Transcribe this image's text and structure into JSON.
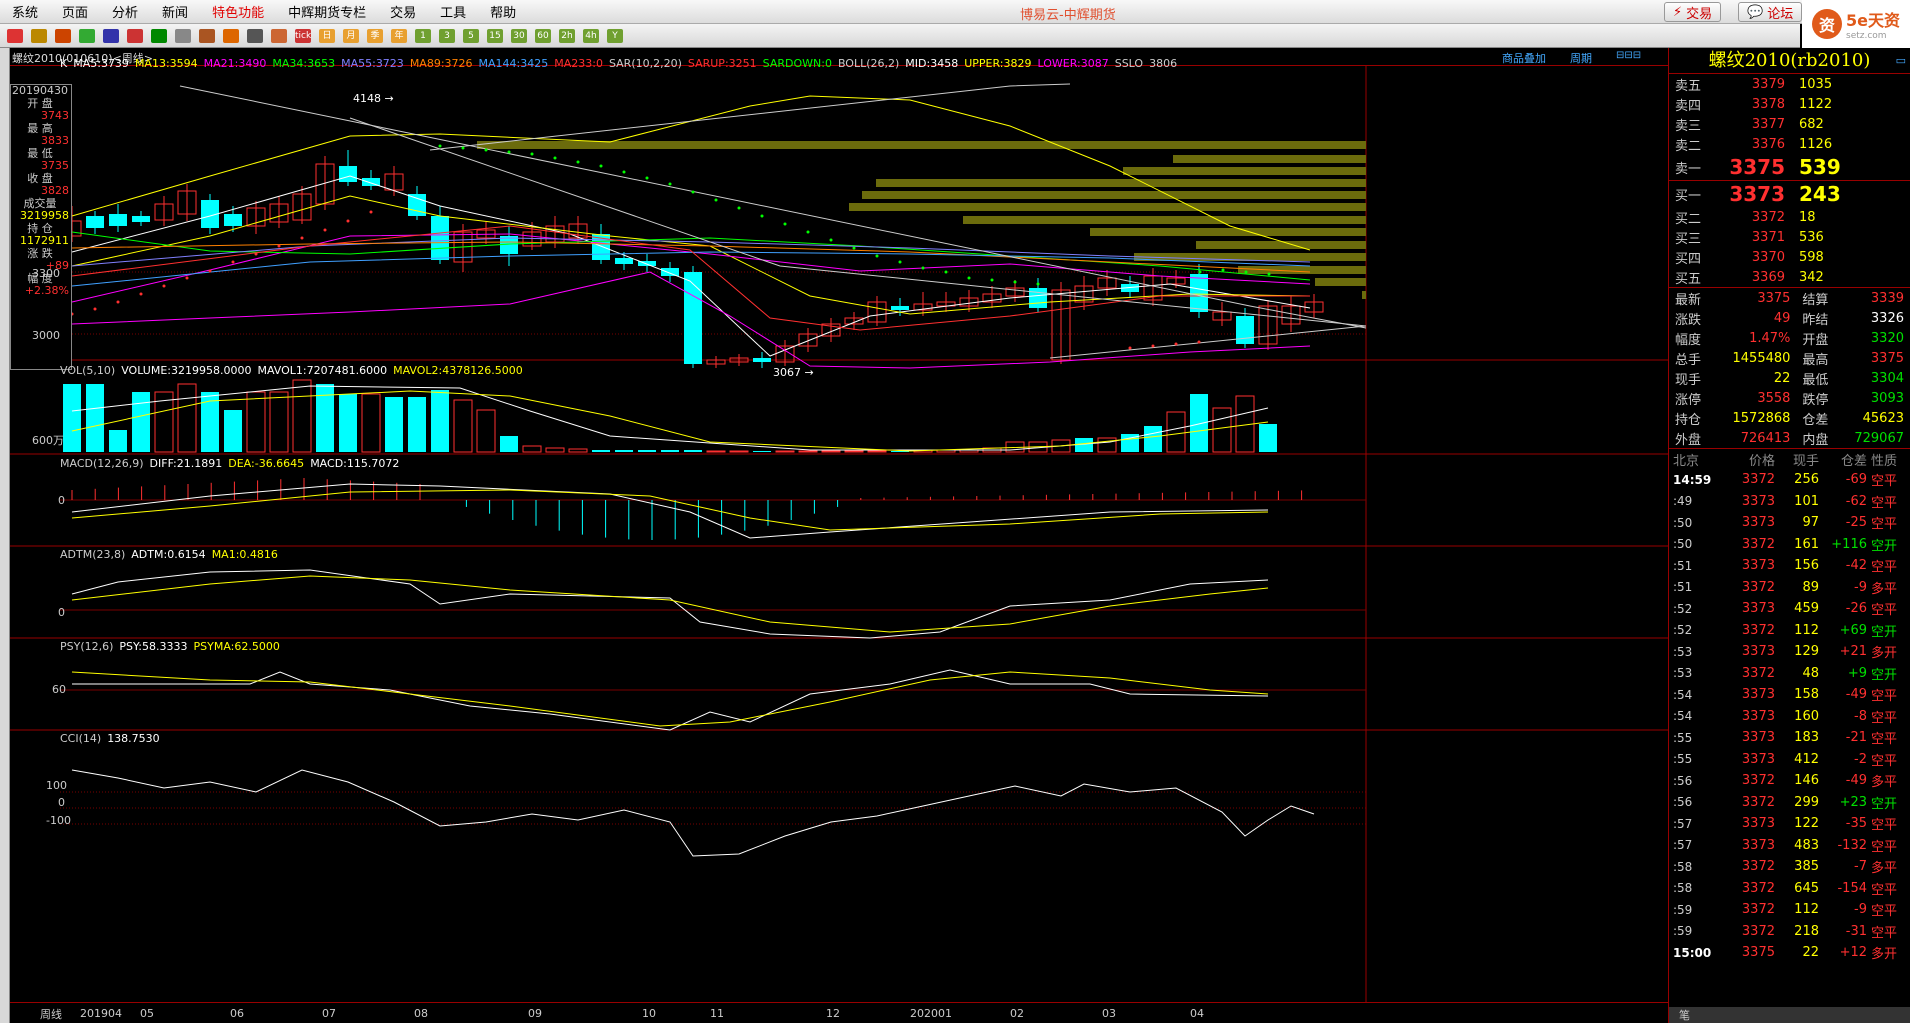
{
  "menu": [
    "系统",
    "页面",
    "分析",
    "新闻",
    "特色功能",
    "中辉期货专栏",
    "交易",
    "工具",
    "帮助"
  ],
  "app_title": "博易云-中辉期货",
  "trade_btn": "交易",
  "forum_btn": "论坛",
  "logo_text": "5e天资",
  "logo_sub": "setz.com",
  "toolbar_labels": [
    "tick",
    "日",
    "月",
    "季",
    "年",
    "1",
    "3",
    "5",
    "15",
    "30",
    "60",
    "2h",
    "4h",
    "Y"
  ],
  "chart_header": {
    "symbol": "螺纹2010(010610)<周线>",
    "overlay_btn": "商品叠加",
    "period_btn": "周期"
  },
  "info_box": {
    "date": "20190430",
    "open_label": "开 盘",
    "open": "3743",
    "high_label": "最 高",
    "high": "3833",
    "low_label": "最 低",
    "low": "3735",
    "close_label": "收 盘",
    "close": "3828",
    "vol_label": "成交量",
    "vol": "3219958",
    "oi_label": "持 仓",
    "oi": "1172911",
    "chg_label": "涨 跌",
    "chg": "+89",
    "pct_label": "幅 度",
    "pct": "+2.38%"
  },
  "main_legend": [
    {
      "text": "K",
      "color": "#ffffff"
    },
    {
      "text": "MA5:3739",
      "color": "#ffffff"
    },
    {
      "text": "MA13:3594",
      "color": "#ffff00"
    },
    {
      "text": "MA21:3490",
      "color": "#ff00ff"
    },
    {
      "text": "MA34:3653",
      "color": "#00ff00"
    },
    {
      "text": "MA55:3723",
      "color": "#8080ff"
    },
    {
      "text": "MA89:3726",
      "color": "#ff8000"
    },
    {
      "text": "MA144:3425",
      "color": "#40a0ff"
    },
    {
      "text": "MA233:0",
      "color": "#ff3030"
    },
    {
      "text": "SAR(10,2,20)",
      "color": "#cccccc"
    },
    {
      "text": "SARUP:3251",
      "color": "#ff3030"
    },
    {
      "text": "SARDOWN:0",
      "color": "#00ff00"
    },
    {
      "text": "BOLL(26,2)",
      "color": "#cccccc"
    },
    {
      "text": "MID:3458",
      "color": "#ffffff"
    },
    {
      "text": "UPPER:3829",
      "color": "#ffff00"
    },
    {
      "text": "LOWER:3087",
      "color": "#ff00ff"
    },
    {
      "text": "SSLO",
      "color": "#cccccc"
    },
    {
      "text": "3806",
      "color": "#cccccc"
    }
  ],
  "price_axis": [
    "3300",
    "3000"
  ],
  "price_marks": {
    "high": "4148",
    "low": "3067"
  },
  "vol_legend": [
    {
      "text": "VOL(5,10)",
      "color": "#cccccc"
    },
    {
      "text": "VOLUME:3219958.0000",
      "color": "#ffffff"
    },
    {
      "text": "MAVOL1:7207481.6000",
      "color": "#ffffff"
    },
    {
      "text": "MAVOL2:4378126.5000",
      "color": "#ffff00"
    }
  ],
  "vol_axis": "600万",
  "macd_legend": [
    {
      "text": "MACD(12,26,9)",
      "color": "#cccccc"
    },
    {
      "text": "DIFF:21.1891",
      "color": "#ffffff"
    },
    {
      "text": "DEA:-36.6645",
      "color": "#ffff00"
    },
    {
      "text": "MACD:115.7072",
      "color": "#ffffff"
    }
  ],
  "adtm_legend": [
    {
      "text": "ADTM(23,8)",
      "color": "#cccccc"
    },
    {
      "text": "ADTM:0.6154",
      "color": "#ffffff"
    },
    {
      "text": "MA1:0.4816",
      "color": "#ffff00"
    }
  ],
  "psy_legend": [
    {
      "text": "PSY(12,6)",
      "color": "#cccccc"
    },
    {
      "text": "PSY:58.3333",
      "color": "#ffffff"
    },
    {
      "text": "PSYMA:62.5000",
      "color": "#ffff00"
    }
  ],
  "cci_legend": [
    {
      "text": "CCI(14)",
      "color": "#cccccc"
    },
    {
      "text": "138.7530",
      "color": "#ffffff"
    }
  ],
  "axis_zero": "0",
  "psy_axis": "60",
  "cci_axis": [
    "100",
    "0",
    "-100"
  ],
  "period_label": "周线",
  "time_axis": [
    "201904",
    "05",
    "06",
    "07",
    "08",
    "09",
    "10",
    "11",
    "12",
    "202001",
    "02",
    "03",
    "04"
  ],
  "quote": {
    "title": "螺纹2010(rb2010)",
    "asks": [
      {
        "label": "卖五",
        "price": "3379",
        "vol": "1035"
      },
      {
        "label": "卖四",
        "price": "3378",
        "vol": "1122"
      },
      {
        "label": "卖三",
        "price": "3377",
        "vol": "682"
      },
      {
        "label": "卖二",
        "price": "3376",
        "vol": "1126"
      },
      {
        "label": "卖一",
        "price": "3375",
        "vol": "539"
      }
    ],
    "bids": [
      {
        "label": "买一",
        "price": "3373",
        "vol": "243"
      },
      {
        "label": "买二",
        "price": "3372",
        "vol": "18"
      },
      {
        "label": "买三",
        "price": "3371",
        "vol": "536"
      },
      {
        "label": "买四",
        "price": "3370",
        "vol": "598"
      },
      {
        "label": "买五",
        "price": "3369",
        "vol": "342"
      }
    ],
    "stats": [
      {
        "l1": "最新",
        "v1": "3375",
        "c1": "red",
        "l2": "结算",
        "v2": "3339",
        "c2": "red"
      },
      {
        "l1": "涨跌",
        "v1": "49",
        "c1": "red",
        "l2": "昨结",
        "v2": "3326",
        "c2": "wht"
      },
      {
        "l1": "幅度",
        "v1": "1.47%",
        "c1": "red",
        "l2": "开盘",
        "v2": "3320",
        "c2": "grn"
      },
      {
        "l1": "总手",
        "v1": "1455480",
        "c1": "yel",
        "l2": "最高",
        "v2": "3375",
        "c2": "red"
      },
      {
        "l1": "现手",
        "v1": "22",
        "c1": "yel",
        "l2": "最低",
        "v2": "3304",
        "c2": "grn"
      },
      {
        "l1": "涨停",
        "v1": "3558",
        "c1": "red",
        "l2": "跌停",
        "v2": "3093",
        "c2": "grn"
      },
      {
        "l1": "持仓",
        "v1": "1572868",
        "c1": "yel",
        "l2": "仓差",
        "v2": "45623",
        "c2": "yel"
      },
      {
        "l1": "外盘",
        "v1": "726413",
        "c1": "red",
        "l2": "内盘",
        "v2": "729067",
        "c2": "grn"
      }
    ],
    "tick_header": [
      "北京",
      "价格",
      "现手",
      "仓差",
      "性质"
    ],
    "ticks": [
      {
        "t": "14:59",
        "p": "3372",
        "q": "256",
        "oi": "-69",
        "n": "空平",
        "oc": "red",
        "nc": "red",
        "pc": "red"
      },
      {
        "t": ":49",
        "p": "3373",
        "q": "101",
        "oi": "-62",
        "n": "空平",
        "oc": "red",
        "nc": "red",
        "pc": "red"
      },
      {
        "t": ":50",
        "p": "3373",
        "q": "97",
        "oi": "-25",
        "n": "空平",
        "oc": "red",
        "nc": "red",
        "pc": "red"
      },
      {
        "t": ":50",
        "p": "3372",
        "q": "161",
        "oi": "+116",
        "n": "空开",
        "oc": "grn",
        "nc": "grn",
        "pc": "red"
      },
      {
        "t": ":51",
        "p": "3373",
        "q": "156",
        "oi": "-42",
        "n": "空平",
        "oc": "red",
        "nc": "red",
        "pc": "red"
      },
      {
        "t": ":51",
        "p": "3372",
        "q": "89",
        "oi": "-9",
        "n": "多平",
        "oc": "red",
        "nc": "red",
        "pc": "red"
      },
      {
        "t": ":52",
        "p": "3373",
        "q": "459",
        "oi": "-26",
        "n": "空平",
        "oc": "red",
        "nc": "red",
        "pc": "red"
      },
      {
        "t": ":52",
        "p": "3372",
        "q": "112",
        "oi": "+69",
        "n": "空开",
        "oc": "grn",
        "nc": "grn",
        "pc": "red"
      },
      {
        "t": ":53",
        "p": "3373",
        "q": "129",
        "oi": "+21",
        "n": "多开",
        "oc": "red",
        "nc": "red",
        "pc": "red"
      },
      {
        "t": ":53",
        "p": "3372",
        "q": "48",
        "oi": "+9",
        "n": "空开",
        "oc": "grn",
        "nc": "grn",
        "pc": "red"
      },
      {
        "t": ":54",
        "p": "3373",
        "q": "158",
        "oi": "-49",
        "n": "空平",
        "oc": "red",
        "nc": "red",
        "pc": "red"
      },
      {
        "t": ":54",
        "p": "3373",
        "q": "160",
        "oi": "-8",
        "n": "空平",
        "oc": "red",
        "nc": "red",
        "pc": "red"
      },
      {
        "t": ":55",
        "p": "3373",
        "q": "183",
        "oi": "-21",
        "n": "空平",
        "oc": "red",
        "nc": "red",
        "pc": "red"
      },
      {
        "t": ":55",
        "p": "3373",
        "q": "412",
        "oi": "-2",
        "n": "空平",
        "oc": "red",
        "nc": "red",
        "pc": "red"
      },
      {
        "t": ":56",
        "p": "3372",
        "q": "146",
        "oi": "-49",
        "n": "多平",
        "oc": "red",
        "nc": "red",
        "pc": "red"
      },
      {
        "t": ":56",
        "p": "3372",
        "q": "299",
        "oi": "+23",
        "n": "空开",
        "oc": "grn",
        "nc": "grn",
        "pc": "red"
      },
      {
        "t": ":57",
        "p": "3373",
        "q": "122",
        "oi": "-35",
        "n": "空平",
        "oc": "red",
        "nc": "red",
        "pc": "red"
      },
      {
        "t": ":57",
        "p": "3373",
        "q": "483",
        "oi": "-132",
        "n": "空平",
        "oc": "red",
        "nc": "red",
        "pc": "red"
      },
      {
        "t": ":58",
        "p": "3372",
        "q": "385",
        "oi": "-7",
        "n": "多平",
        "oc": "red",
        "nc": "red",
        "pc": "red"
      },
      {
        "t": ":58",
        "p": "3372",
        "q": "645",
        "oi": "-154",
        "n": "空平",
        "oc": "red",
        "nc": "red",
        "pc": "red"
      },
      {
        "t": ":59",
        "p": "3372",
        "q": "112",
        "oi": "-9",
        "n": "空平",
        "oc": "red",
        "nc": "red",
        "pc": "red"
      },
      {
        "t": ":59",
        "p": "3372",
        "q": "218",
        "oi": "-31",
        "n": "空平",
        "oc": "red",
        "nc": "red",
        "pc": "red"
      },
      {
        "t": "15:00",
        "p": "3375",
        "q": "22",
        "oi": "+12",
        "n": "多开",
        "oc": "red",
        "nc": "red",
        "pc": "red"
      }
    ],
    "bottom_tab": "笔"
  }
}
